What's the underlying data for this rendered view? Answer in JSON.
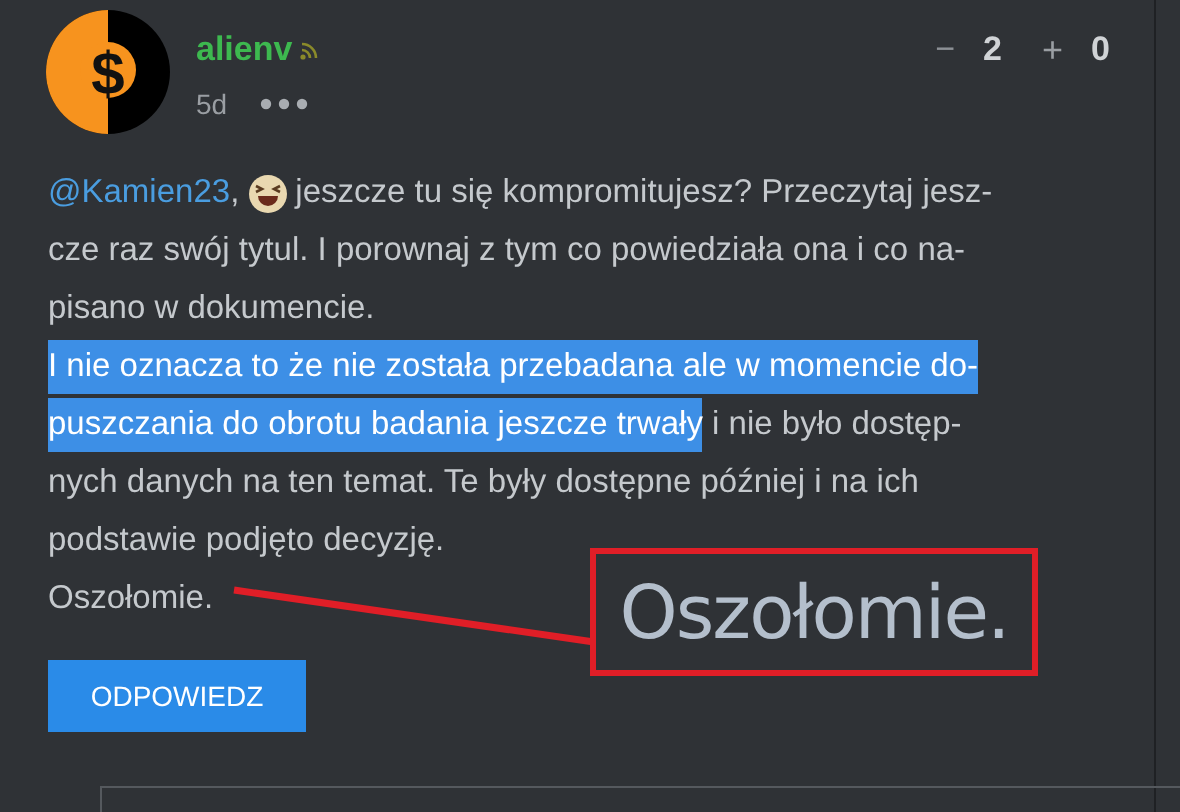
{
  "post": {
    "avatar_symbol": "$",
    "author": "alienv",
    "time": "5d",
    "votes": [
      {
        "kind": "minus",
        "sign": "−",
        "count": "2"
      },
      {
        "kind": "plus",
        "sign": "+",
        "count": "0"
      }
    ],
    "lines": [
      [
        {
          "kind": "mention",
          "text": "@Kamien23"
        },
        {
          "kind": "text",
          "text": ","
        },
        {
          "kind": "emoji"
        },
        {
          "kind": "text",
          "text": "jeszcze tu się kompromitujesz? Przeczytaj jesz-"
        }
      ],
      [
        {
          "kind": "text",
          "text": "cze raz swój tytul. I porownaj z tym co powiedziała ona i co na-"
        }
      ],
      [
        {
          "kind": "text",
          "text": "pisano w dokumencie."
        }
      ],
      [
        {
          "kind": "highlight",
          "text": "I nie oznacza to że nie została przebadana ale w momencie do-"
        }
      ],
      [
        {
          "kind": "highlight",
          "text": "puszczania do obrotu badania jeszcze trwały"
        },
        {
          "kind": "text",
          "text": " i nie było dostęp-"
        }
      ],
      [
        {
          "kind": "text",
          "text": "nych danych na ten temat. Te były dostępne później i na ich"
        }
      ],
      [
        {
          "kind": "text",
          "text": "podstawie podjęto decyzję."
        }
      ],
      [
        {
          "kind": "text",
          "text": "Oszołomie."
        }
      ]
    ],
    "reply_button": "ODPOWIEDZ",
    "annotation": {
      "text": "Oszołomie."
    }
  }
}
